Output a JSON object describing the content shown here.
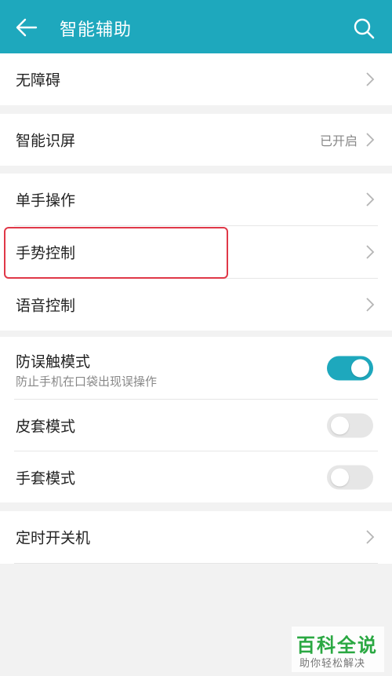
{
  "header": {
    "title": "智能辅助",
    "back_icon": "arrow-left-icon",
    "search_icon": "search-icon",
    "color": "#1ea8bd"
  },
  "groups": [
    {
      "items": [
        {
          "label": "无障碍"
        }
      ]
    },
    {
      "items": [
        {
          "label": "智能识屏",
          "value": "已开启"
        }
      ]
    },
    {
      "items": [
        {
          "label": "单手操作"
        },
        {
          "label": "手势控制"
        },
        {
          "label": "语音控制"
        }
      ]
    },
    {
      "items": [
        {
          "label": "防误触模式",
          "sublabel": "防止手机在口袋出现误操作",
          "toggle": "on"
        },
        {
          "label": "皮套模式",
          "toggle": "off"
        },
        {
          "label": "手套模式",
          "toggle": "off"
        }
      ]
    },
    {
      "items": [
        {
          "label": "定时开关机"
        }
      ]
    }
  ],
  "highlight_color": "#e03848",
  "watermark": {
    "title": "百科全说",
    "subtitle": "助你轻松解决"
  }
}
